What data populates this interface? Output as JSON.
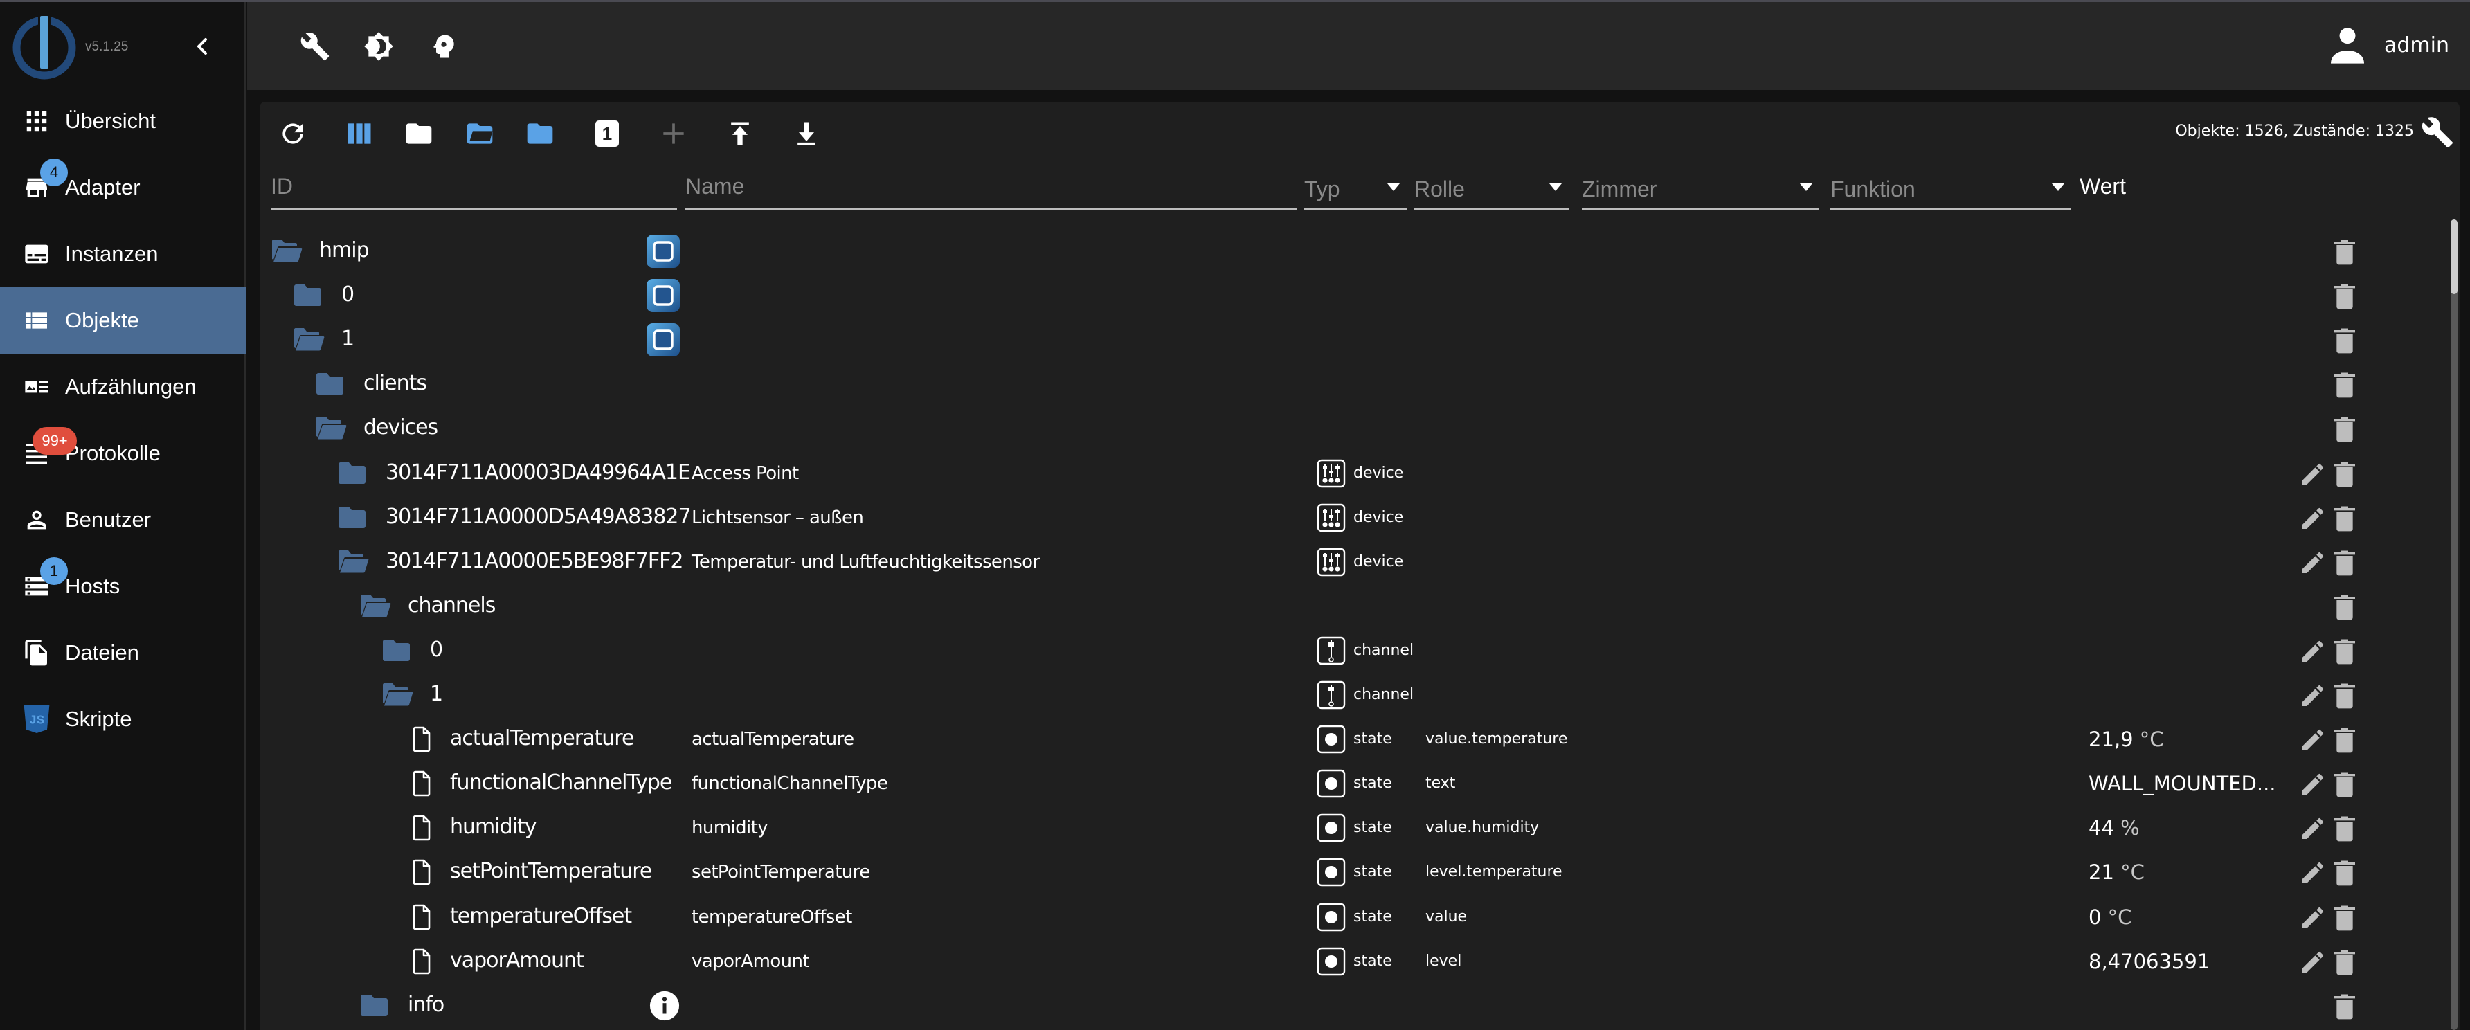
{
  "app": {
    "version": "v5.1.25",
    "user": "admin",
    "colors": {
      "accent": "#5aa2e6",
      "active_nav": "#4a6b93",
      "folder": "#4a6b93",
      "badge_red": "#e04e3d",
      "panel_bg": "#1f1f1f",
      "topbar_bg": "#272727"
    }
  },
  "topbar": {
    "icons": [
      "wrench-icon",
      "theme-toggle-icon",
      "expert-mode-icon"
    ]
  },
  "sidebar": {
    "items": [
      {
        "label": "Übersicht",
        "icon": "grid-icon",
        "badge": null,
        "active": false
      },
      {
        "label": "Adapter",
        "icon": "store-icon",
        "badge": "4",
        "active": false
      },
      {
        "label": "Instanzen",
        "icon": "instances-icon",
        "badge": null,
        "active": false
      },
      {
        "label": "Objekte",
        "icon": "list-icon",
        "badge": null,
        "active": true
      },
      {
        "label": "Aufzählungen",
        "icon": "enums-icon",
        "badge": null,
        "active": false
      },
      {
        "label": "Protokolle",
        "icon": "logs-icon",
        "badge": "99+",
        "active": false
      },
      {
        "label": "Benutzer",
        "icon": "user-icon",
        "badge": null,
        "active": false
      },
      {
        "label": "Hosts",
        "icon": "hosts-icon",
        "badge": "1",
        "active": false
      },
      {
        "label": "Dateien",
        "icon": "files-icon",
        "badge": null,
        "active": false
      },
      {
        "label": "Skripte",
        "icon": "javascript-icon",
        "badge": null,
        "active": false
      }
    ]
  },
  "toolbar": {
    "buttons": [
      "refresh",
      "columns",
      "collapse-all",
      "expand-all",
      "expand-one-level",
      "toggle-expert",
      "add-object",
      "upload",
      "download"
    ],
    "toggle_badge_text": "1",
    "counts_text": "Objekte: 1526, Zustände: 1325"
  },
  "filters": {
    "id_placeholder": "ID",
    "name_placeholder": "Name",
    "typ_label": "Typ",
    "rolle_label": "Rolle",
    "zimmer_label": "Zimmer",
    "funktion_label": "Funktion",
    "wert_header": "Wert"
  },
  "rows": [
    {
      "level": 0,
      "id": "hmip",
      "icon": "folder-open",
      "name": "",
      "adapter_icon": true,
      "typ": "",
      "role": "",
      "value": "",
      "unit": "",
      "edit": false
    },
    {
      "level": 1,
      "id": "0",
      "icon": "folder",
      "name": "",
      "adapter_icon": true,
      "typ": "",
      "role": "",
      "value": "",
      "unit": "",
      "edit": false
    },
    {
      "level": 1,
      "id": "1",
      "icon": "folder-open",
      "name": "",
      "adapter_icon": true,
      "typ": "",
      "role": "",
      "value": "",
      "unit": "",
      "edit": false
    },
    {
      "level": 2,
      "id": "clients",
      "icon": "folder",
      "name": "",
      "typ": "",
      "role": "",
      "value": "",
      "unit": "",
      "edit": false
    },
    {
      "level": 2,
      "id": "devices",
      "icon": "folder-open",
      "name": "",
      "typ": "",
      "role": "",
      "value": "",
      "unit": "",
      "edit": false
    },
    {
      "level": 3,
      "id": "3014F711A00003DA49964A1E",
      "icon": "folder",
      "name": "Access Point",
      "typ": "device",
      "role": "",
      "value": "",
      "unit": "",
      "edit": true
    },
    {
      "level": 3,
      "id": "3014F711A0000D5A49A83827",
      "icon": "folder",
      "name": "Lichtsensor – außen",
      "typ": "device",
      "role": "",
      "value": "",
      "unit": "",
      "edit": true
    },
    {
      "level": 3,
      "id": "3014F711A0000E5BE98F7FF2",
      "icon": "folder-open",
      "name": "Temperatur- und Luftfeuchtigkeitssensor",
      "typ": "device",
      "role": "",
      "value": "",
      "unit": "",
      "edit": true
    },
    {
      "level": 4,
      "id": "channels",
      "icon": "folder-open",
      "name": "",
      "typ": "",
      "role": "",
      "value": "",
      "unit": "",
      "edit": false
    },
    {
      "level": 5,
      "id": "0",
      "icon": "folder",
      "name": "",
      "typ": "channel",
      "role": "",
      "value": "",
      "unit": "",
      "edit": true
    },
    {
      "level": 5,
      "id": "1",
      "icon": "folder-open",
      "name": "",
      "typ": "channel",
      "role": "",
      "value": "",
      "unit": "",
      "edit": true
    },
    {
      "level": 6,
      "id": "actualTemperature",
      "icon": "file",
      "name": "actualTemperature",
      "typ": "state",
      "role": "value.temperature",
      "value": "21,9",
      "unit": " °C",
      "edit": true
    },
    {
      "level": 6,
      "id": "functionalChannelType",
      "icon": "file",
      "name": "functionalChannelType",
      "typ": "state",
      "role": "text",
      "value": "WALL_MOUNTED...",
      "unit": "",
      "edit": true
    },
    {
      "level": 6,
      "id": "humidity",
      "icon": "file",
      "name": "humidity",
      "typ": "state",
      "role": "value.humidity",
      "value": "44",
      "unit": " %",
      "edit": true
    },
    {
      "level": 6,
      "id": "setPointTemperature",
      "icon": "file",
      "name": "setPointTemperature",
      "typ": "state",
      "role": "level.temperature",
      "value": "21",
      "unit": " °C",
      "edit": true
    },
    {
      "level": 6,
      "id": "temperatureOffset",
      "icon": "file",
      "name": "temperatureOffset",
      "typ": "state",
      "role": "value",
      "value": "0",
      "unit": " °C",
      "edit": true
    },
    {
      "level": 6,
      "id": "vaporAmount",
      "icon": "file",
      "name": "vaporAmount",
      "typ": "state",
      "role": "level",
      "value": "8,47063591",
      "unit": "",
      "edit": true
    },
    {
      "level": 4,
      "id": "info",
      "icon": "folder",
      "name": "",
      "info_icon": true,
      "typ": "",
      "role": "",
      "value": "",
      "unit": "",
      "edit": false
    }
  ]
}
